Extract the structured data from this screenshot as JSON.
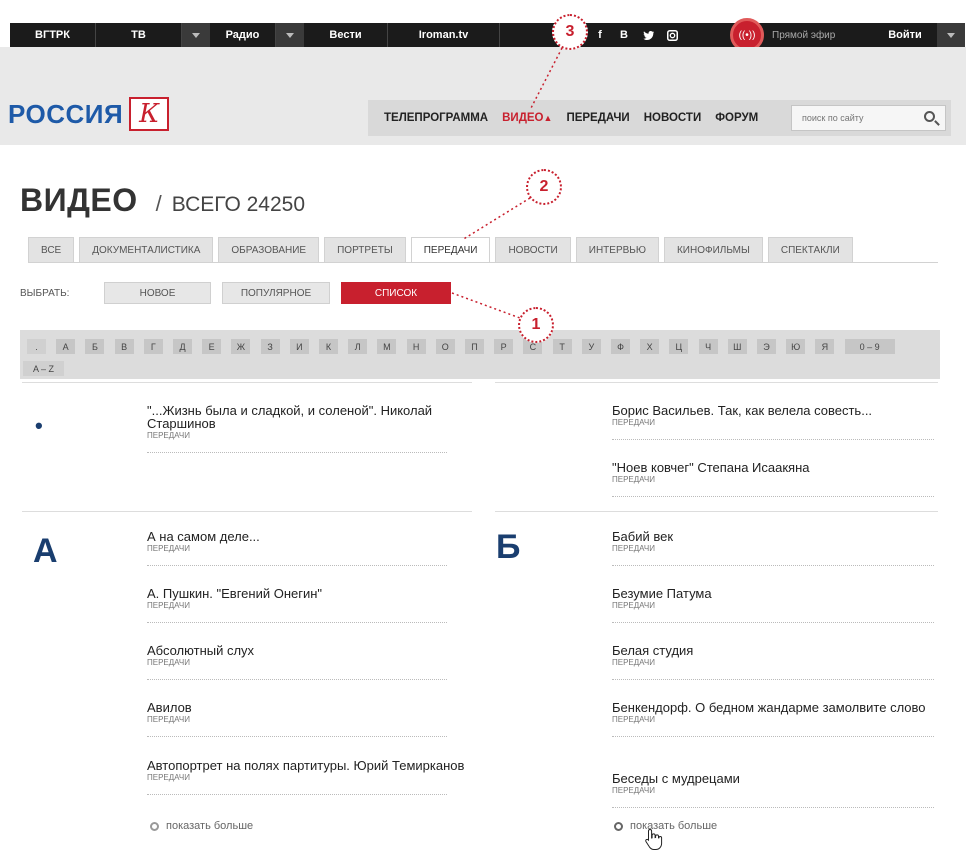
{
  "topbar": {
    "items": [
      "ВГТРК",
      "ТВ",
      "Радио",
      "Вести",
      "Iroman.tv"
    ],
    "social": [
      "f",
      "В",
      "tw",
      "ig"
    ],
    "live_label": "Прямой эфир",
    "login": "Войти"
  },
  "logo": {
    "word": "РОССИЯ",
    "letter": "К"
  },
  "nav": {
    "items": [
      "ТЕЛЕПРОГРАММА",
      "ВИДЕО",
      "ПЕРЕДАЧИ",
      "НОВОСТИ",
      "ФОРУМ"
    ],
    "search_placeholder": "поиск по сайту"
  },
  "page": {
    "title": "ВИДЕО",
    "separator": "/",
    "count": "ВСЕГО 24250"
  },
  "tabs": [
    "ВСЕ",
    "ДОКУМЕНТАЛИСТИКА",
    "ОБРАЗОВАНИЕ",
    "ПОРТРЕТЫ",
    "ПЕРЕДАЧИ",
    "НОВОСТИ",
    "ИНТЕРВЬЮ",
    "КИНОФИЛЬМЫ",
    "СПЕКТАКЛИ"
  ],
  "filter": {
    "label": "ВЫБРАТЬ:",
    "options": [
      "НОВОЕ",
      "ПОПУЛЯРНОЕ",
      "СПИСОК"
    ]
  },
  "alphabet": [
    ".",
    "А",
    "Б",
    "В",
    "Г",
    "Д",
    "Е",
    "Ж",
    "З",
    "И",
    "К",
    "Л",
    "М",
    "Н",
    "О",
    "П",
    "Р",
    "С",
    "Т",
    "У",
    "Ф",
    "Х",
    "Ц",
    "Ч",
    "Ш",
    "Э",
    "Ю",
    "Я",
    "0 – 9",
    "A – Z"
  ],
  "markers": [
    "1",
    "2",
    "3"
  ],
  "sections": {
    "dot": {
      "letter": "•",
      "left": [
        {
          "title": "\"...Жизнь была и сладкой, и соленой\". Николай Старшинов",
          "sub": "ПЕРЕДАЧИ"
        }
      ],
      "right": [
        {
          "title": "Борис Васильев. Так, как велела совесть...",
          "sub": "ПЕРЕДАЧИ"
        },
        {
          "title": "\"Ноев ковчег\" Степана Исаакяна",
          "sub": "ПЕРЕДАЧИ"
        }
      ]
    },
    "a": {
      "letter": "А",
      "items": [
        {
          "title": "А на самом деле...",
          "sub": "ПЕРЕДАЧИ"
        },
        {
          "title": "А. Пушкин. \"Евгений Онегин\"",
          "sub": "ПЕРЕДАЧИ"
        },
        {
          "title": "Абсолютный слух",
          "sub": "ПЕРЕДАЧИ"
        },
        {
          "title": "Авилов",
          "sub": "ПЕРЕДАЧИ"
        },
        {
          "title": "Автопортрет на полях партитуры. Юрий Темирканов",
          "sub": "ПЕРЕДАЧИ"
        }
      ],
      "more": "показать больше"
    },
    "b": {
      "letter": "Б",
      "items": [
        {
          "title": "Бабий век",
          "sub": "ПЕРЕДАЧИ"
        },
        {
          "title": "Безумие Патума",
          "sub": "ПЕРЕДАЧИ"
        },
        {
          "title": "Белая студия",
          "sub": "ПЕРЕДАЧИ"
        },
        {
          "title": "Бенкендорф. О бедном жандарме замолвите слово",
          "sub": "ПЕРЕДАЧИ"
        },
        {
          "title": "Беседы с мудрецами",
          "sub": "ПЕРЕДАЧИ"
        }
      ],
      "more": "показать больше"
    }
  }
}
